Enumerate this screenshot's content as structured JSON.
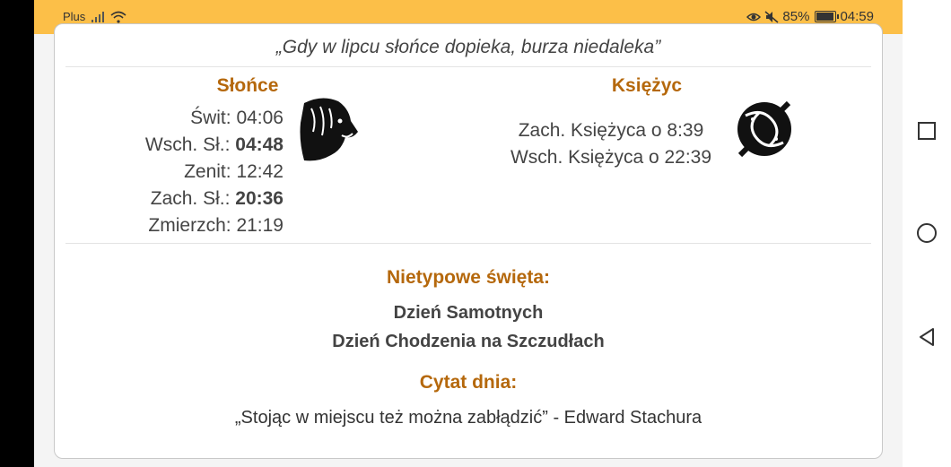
{
  "status": {
    "carrier": "Plus",
    "battery": "85%",
    "battery_level": 0.85,
    "time": "04:59",
    "icons": [
      "signal-icon",
      "wifi-icon",
      "eye-icon",
      "mute-icon",
      "battery-icon"
    ]
  },
  "proverb": "„Gdy w lipcu słońce dopieka, burza niedaleka”",
  "sun": {
    "title": "Słońce",
    "rows": [
      {
        "label": "Świt: ",
        "value": "04:06",
        "bold": false
      },
      {
        "label": "Wsch. Sł.: ",
        "value": "04:48",
        "bold": true
      },
      {
        "label": "Zenit: ",
        "value": "12:42",
        "bold": false
      },
      {
        "label": "Zach. Sł.: ",
        "value": "20:36",
        "bold": true
      },
      {
        "label": "Zmierzch: ",
        "value": "21:19",
        "bold": false
      }
    ],
    "icon": "leo-lion-icon"
  },
  "moon": {
    "title": "Księżyc",
    "rows": [
      "Zach. Księżyca o 8:39",
      "Wsch. Księżyca o 22:39"
    ],
    "icon": "pisces-fish-icon"
  },
  "holidays": {
    "title": "Nietypowe święta:",
    "items": [
      "Dzień Samotnych",
      "Dzień Chodzenia na Szczudłach"
    ]
  },
  "quote_of_day": {
    "title": "Cytat dnia:",
    "text": "„Stojąc w miejscu też można zabłądzić” -  Edward Stachura"
  },
  "colors": {
    "statusbar": "#fcbf48",
    "accent": "#b5680c",
    "text": "#444444"
  },
  "nav": [
    "square-recents-icon",
    "circle-home-icon",
    "triangle-back-icon"
  ]
}
